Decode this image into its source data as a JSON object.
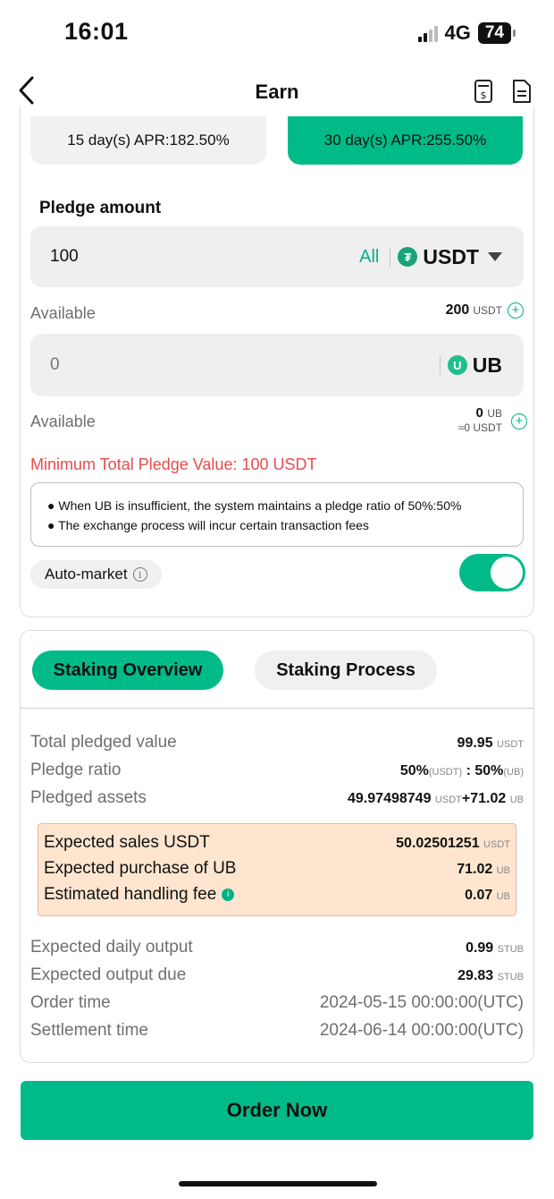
{
  "status": {
    "time": "16:01",
    "network": "4G",
    "battery": "74"
  },
  "nav": {
    "title": "Earn",
    "back_icon": "chevron-left-icon"
  },
  "terms": [
    {
      "label": "15 day(s) APR:182.50%",
      "selected": false
    },
    {
      "label": "30 day(s) APR:255.50%",
      "selected": true
    }
  ],
  "pledge": {
    "title": "Pledge amount",
    "amount_value": "100",
    "all_label": "All",
    "currency": "USDT",
    "available_label": "Available",
    "available_amount": "200",
    "available_unit": "USDT",
    "ub_value": "0",
    "ub_currency": "UB",
    "ub_available_label": "Available",
    "ub_available_amount": "0",
    "ub_available_unit": "UB",
    "ub_available_approx": "≈0 USDT",
    "minimum_notice": "Minimum Total Pledge Value: 100 USDT",
    "notes": [
      "When UB is insufficient, the system maintains a pledge ratio of 50%:50%",
      "The exchange process will incur certain transaction fees"
    ],
    "auto_market_label": "Auto-market",
    "auto_market_on": true
  },
  "tabs": {
    "overview": "Staking Overview",
    "process": "Staking Process"
  },
  "overview": {
    "total_pledged_label": "Total pledged value",
    "total_pledged_value": "99.95",
    "total_pledged_unit": "USDT",
    "ratio_label": "Pledge ratio",
    "ratio_a": "50%",
    "ratio_a_unit": "(USDT)",
    "ratio_sep": " : ",
    "ratio_b": "50%",
    "ratio_b_unit": "(UB)",
    "assets_label": "Pledged assets",
    "assets_usdt": "49.97498749",
    "assets_usdt_unit": "USDT",
    "assets_ub": "+71.02",
    "assets_ub_unit": "UB",
    "sales_label": "Expected sales USDT",
    "sales_value": "50.02501251",
    "sales_unit": "USDT",
    "purchase_label": "Expected purchase of UB",
    "purchase_value": "71.02",
    "purchase_unit": "UB",
    "fee_label": "Estimated handling fee",
    "fee_value": "0.07",
    "fee_unit": "UB",
    "daily_label": "Expected daily output",
    "daily_value": "0.99",
    "daily_unit": "STUB",
    "due_label": "Expected output due",
    "due_value": "29.83",
    "due_unit": "STUB",
    "order_time_label": "Order time",
    "order_time_value": "2024-05-15 00:00:00(UTC)",
    "settle_label": "Settlement time",
    "settle_value": "2024-06-14 00:00:00(UTC)"
  },
  "order_button": "Order Now",
  "colors": {
    "accent": "#00bb88",
    "warning": "#e94b4b",
    "highlight_bg": "#fde5cf"
  }
}
